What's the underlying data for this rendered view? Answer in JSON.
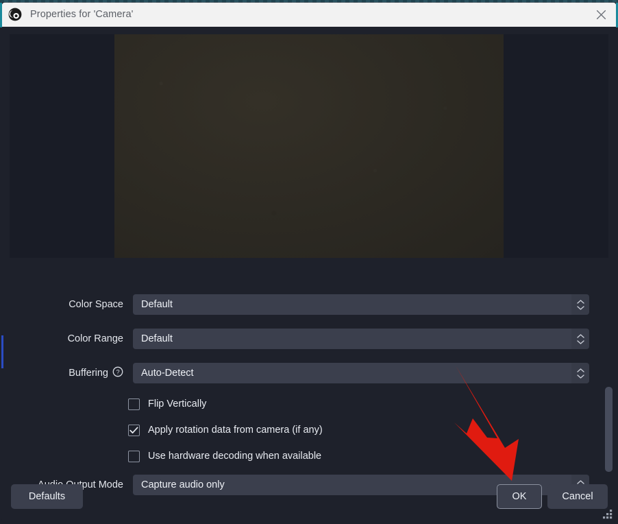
{
  "window": {
    "title": "Properties for 'Camera'",
    "app_icon": "obs-logo-icon",
    "close_icon": "close-icon",
    "accent_color": "#1b8a9c",
    "titlebar_bg": "#f2f2f2",
    "body_bg": "#1e212b"
  },
  "preview": {
    "name": "camera-preview",
    "feed_bg": "#2d2a23",
    "panel_bg": "#191c26"
  },
  "form": {
    "rows": [
      {
        "label": "Color Space",
        "value": "Default",
        "help": false
      },
      {
        "label": "Color Range",
        "value": "Default",
        "help": false
      },
      {
        "label": "Buffering",
        "value": "Auto-Detect",
        "help": true
      },
      {
        "label": "Audio Output Mode",
        "value": "Capture audio only",
        "help": false
      }
    ],
    "checkboxes": [
      {
        "label": "Flip Vertically",
        "checked": false
      },
      {
        "label": "Apply rotation data from camera (if any)",
        "checked": true
      },
      {
        "label": "Use hardware decoding when available",
        "checked": false
      }
    ]
  },
  "footer": {
    "defaults_label": "Defaults",
    "ok_label": "OK",
    "cancel_label": "Cancel"
  },
  "annotation": {
    "arrow_color": "#e01b10",
    "points_at": "OK"
  },
  "scrollbar": {
    "thumb_color": "#474c5c"
  }
}
